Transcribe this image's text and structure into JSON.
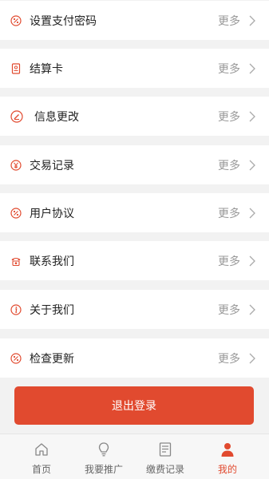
{
  "menu": {
    "more_label": "更多",
    "items": [
      {
        "label": "设置支付密码",
        "icon": "percent-badge-icon"
      },
      {
        "label": "结算卡",
        "icon": "card-icon"
      },
      {
        "label": "信息更改",
        "icon": "edit-icon"
      },
      {
        "label": "交易记录",
        "icon": "yen-icon"
      },
      {
        "label": "用户协议",
        "icon": "percent-badge-icon"
      },
      {
        "label": "联系我们",
        "icon": "phone-icon"
      },
      {
        "label": "关于我们",
        "icon": "info-icon"
      },
      {
        "label": "检查更新",
        "icon": "percent-badge-icon"
      }
    ]
  },
  "logout": {
    "label": "退出登录"
  },
  "tabbar": {
    "tabs": [
      {
        "label": "首页",
        "icon": "home-icon"
      },
      {
        "label": "我要推广",
        "icon": "lightbulb-icon"
      },
      {
        "label": "缴费记录",
        "icon": "document-icon"
      },
      {
        "label": "我的",
        "icon": "user-icon"
      }
    ],
    "active_index": 3
  },
  "colors": {
    "accent": "#e14a2f",
    "background": "#f2f2f2",
    "muted_text": "#999999"
  }
}
